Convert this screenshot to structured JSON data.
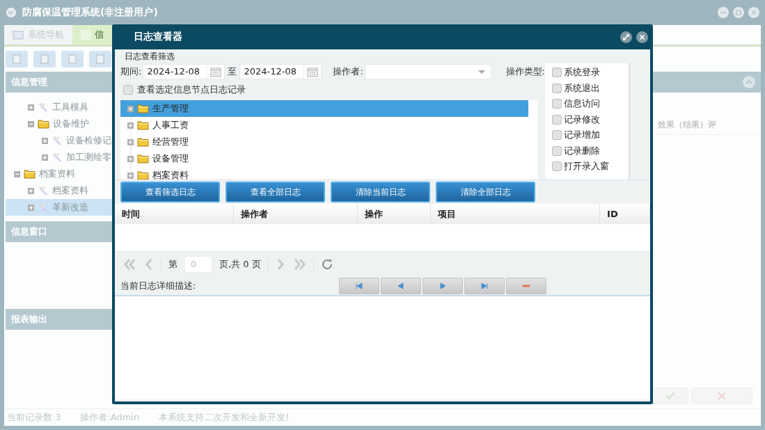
{
  "app": {
    "title": "防腐保温管理系统(非注册用户)"
  },
  "tabs": [
    {
      "label": "系统导航",
      "selected": false
    },
    {
      "label": "信",
      "selected": true
    }
  ],
  "left_panels": [
    {
      "title": "信息管理"
    },
    {
      "title": "信息窗口"
    },
    {
      "title": "报表输出"
    }
  ],
  "nav_tree": [
    {
      "children": [
        {
          "label": "工具模具",
          "kind": "tool",
          "expanded": false,
          "selected": false
        },
        {
          "label": "设备维护",
          "kind": "folder",
          "expanded": true,
          "selected": false,
          "children": [
            {
              "label": "设备检修记",
              "kind": "tool",
              "expanded": false,
              "selected": false
            },
            {
              "label": "加工测绘零",
              "kind": "tool",
              "expanded": false,
              "selected": false
            }
          ]
        }
      ]
    },
    {
      "label": "档案资料",
      "kind": "folder",
      "expanded": true,
      "selected": false,
      "children": [
        {
          "label": "档案资料",
          "kind": "tool",
          "expanded": false,
          "selected": false
        },
        {
          "label": "革新改造",
          "kind": "tool",
          "expanded": false,
          "selected": true
        }
      ]
    }
  ],
  "main_table": {
    "columns": [
      "效果（结果）评"
    ]
  },
  "status_bar": [
    "当前记录数 3",
    "操作者:Admin",
    "本系统支持二次开发和全新开发!"
  ],
  "dialog": {
    "title": "日志查看器",
    "filter": {
      "title": "日志查看筛选",
      "period_label": "期间:",
      "date_from": "2024-12-08",
      "to_label": "至",
      "date_to": "2024-12-08",
      "operator_label": "操作者:",
      "type_label": "操作类型:",
      "types": [
        {
          "label": "系统登录",
          "checked": false
        },
        {
          "label": "系统退出",
          "checked": false
        },
        {
          "label": "信息访问",
          "checked": false
        },
        {
          "label": "记录修改",
          "checked": false
        },
        {
          "label": "记录增加",
          "checked": false
        },
        {
          "label": "记录删除",
          "checked": false
        },
        {
          "label": "打开录入窗",
          "checked": false
        }
      ],
      "node_filter": {
        "label": "查看选定信息节点日志记录",
        "checked": false
      },
      "tree": [
        {
          "label": "生产管理",
          "expanded": false,
          "selected": true
        },
        {
          "label": "人事工资",
          "expanded": false,
          "selected": false
        },
        {
          "label": "经营管理",
          "expanded": false,
          "selected": false
        },
        {
          "label": "设备管理",
          "expanded": false,
          "selected": false
        },
        {
          "label": "档案资料",
          "expanded": false,
          "selected": false
        }
      ]
    },
    "buttons": [
      "查看筛选日志",
      "查看全部日志",
      "清除当前日志",
      "清除全部日志"
    ],
    "columns": [
      "时间",
      "操作者",
      "操作",
      "项目",
      "ID"
    ],
    "pager": {
      "page_prefix": "第",
      "page": "0",
      "page_suffix": "页,共 0 页"
    },
    "detail_label": "当前日志详细描述:"
  }
}
